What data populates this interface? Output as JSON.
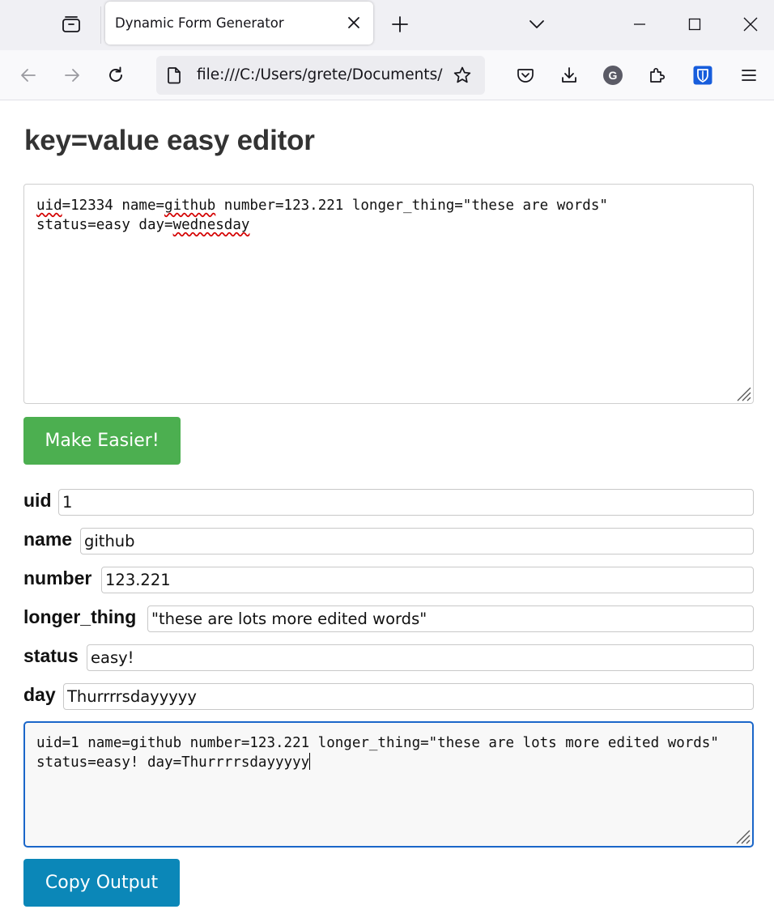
{
  "browser": {
    "tab_title": "Dynamic Form Generator",
    "url": "file:///C:/Users/grete/Documents/",
    "icons": [
      "tab-list-icon",
      "close-icon",
      "plus-icon",
      "chevron-down-icon",
      "minimize-icon",
      "maximize-icon",
      "close-window-icon",
      "back-arrow-icon",
      "forward-arrow-icon",
      "reload-icon",
      "page-icon",
      "star-icon",
      "pocket-icon",
      "download-icon",
      "account-icon",
      "extensions-icon",
      "bitwarden-icon",
      "menu-icon"
    ],
    "account_initial": "G"
  },
  "page": {
    "title": "key=value easy editor",
    "input_text": {
      "line1_a": "uid",
      "line1_b": "=12334 name=",
      "line1_c": "github",
      "line1_d": " number=123.221 longer_thing=\"these are words\"",
      "line2_a": "status=easy day=",
      "line2_b": "wednesday"
    },
    "make_button_label": "Make Easier!",
    "fields": [
      {
        "key": "uid",
        "value": "1"
      },
      {
        "key": "name",
        "value": "github"
      },
      {
        "key": "number",
        "value": "123.221"
      },
      {
        "key": "longer_thing",
        "value": "\"these are lots more edited words\""
      },
      {
        "key": "status",
        "value": "easy!"
      },
      {
        "key": "day",
        "value": "Thurrrrsdayyyyy"
      }
    ],
    "output_text": "uid=1 name=github number=123.221 longer_thing=\"these are lots more edited words\" status=easy! day=Thurrrrsdayyyyy",
    "copy_button_label": "Copy Output"
  },
  "colors": {
    "make_button": "#4caf50",
    "copy_button": "#0b87b8",
    "focus_border": "#1a66c9",
    "spellcheck": "#d40000"
  }
}
